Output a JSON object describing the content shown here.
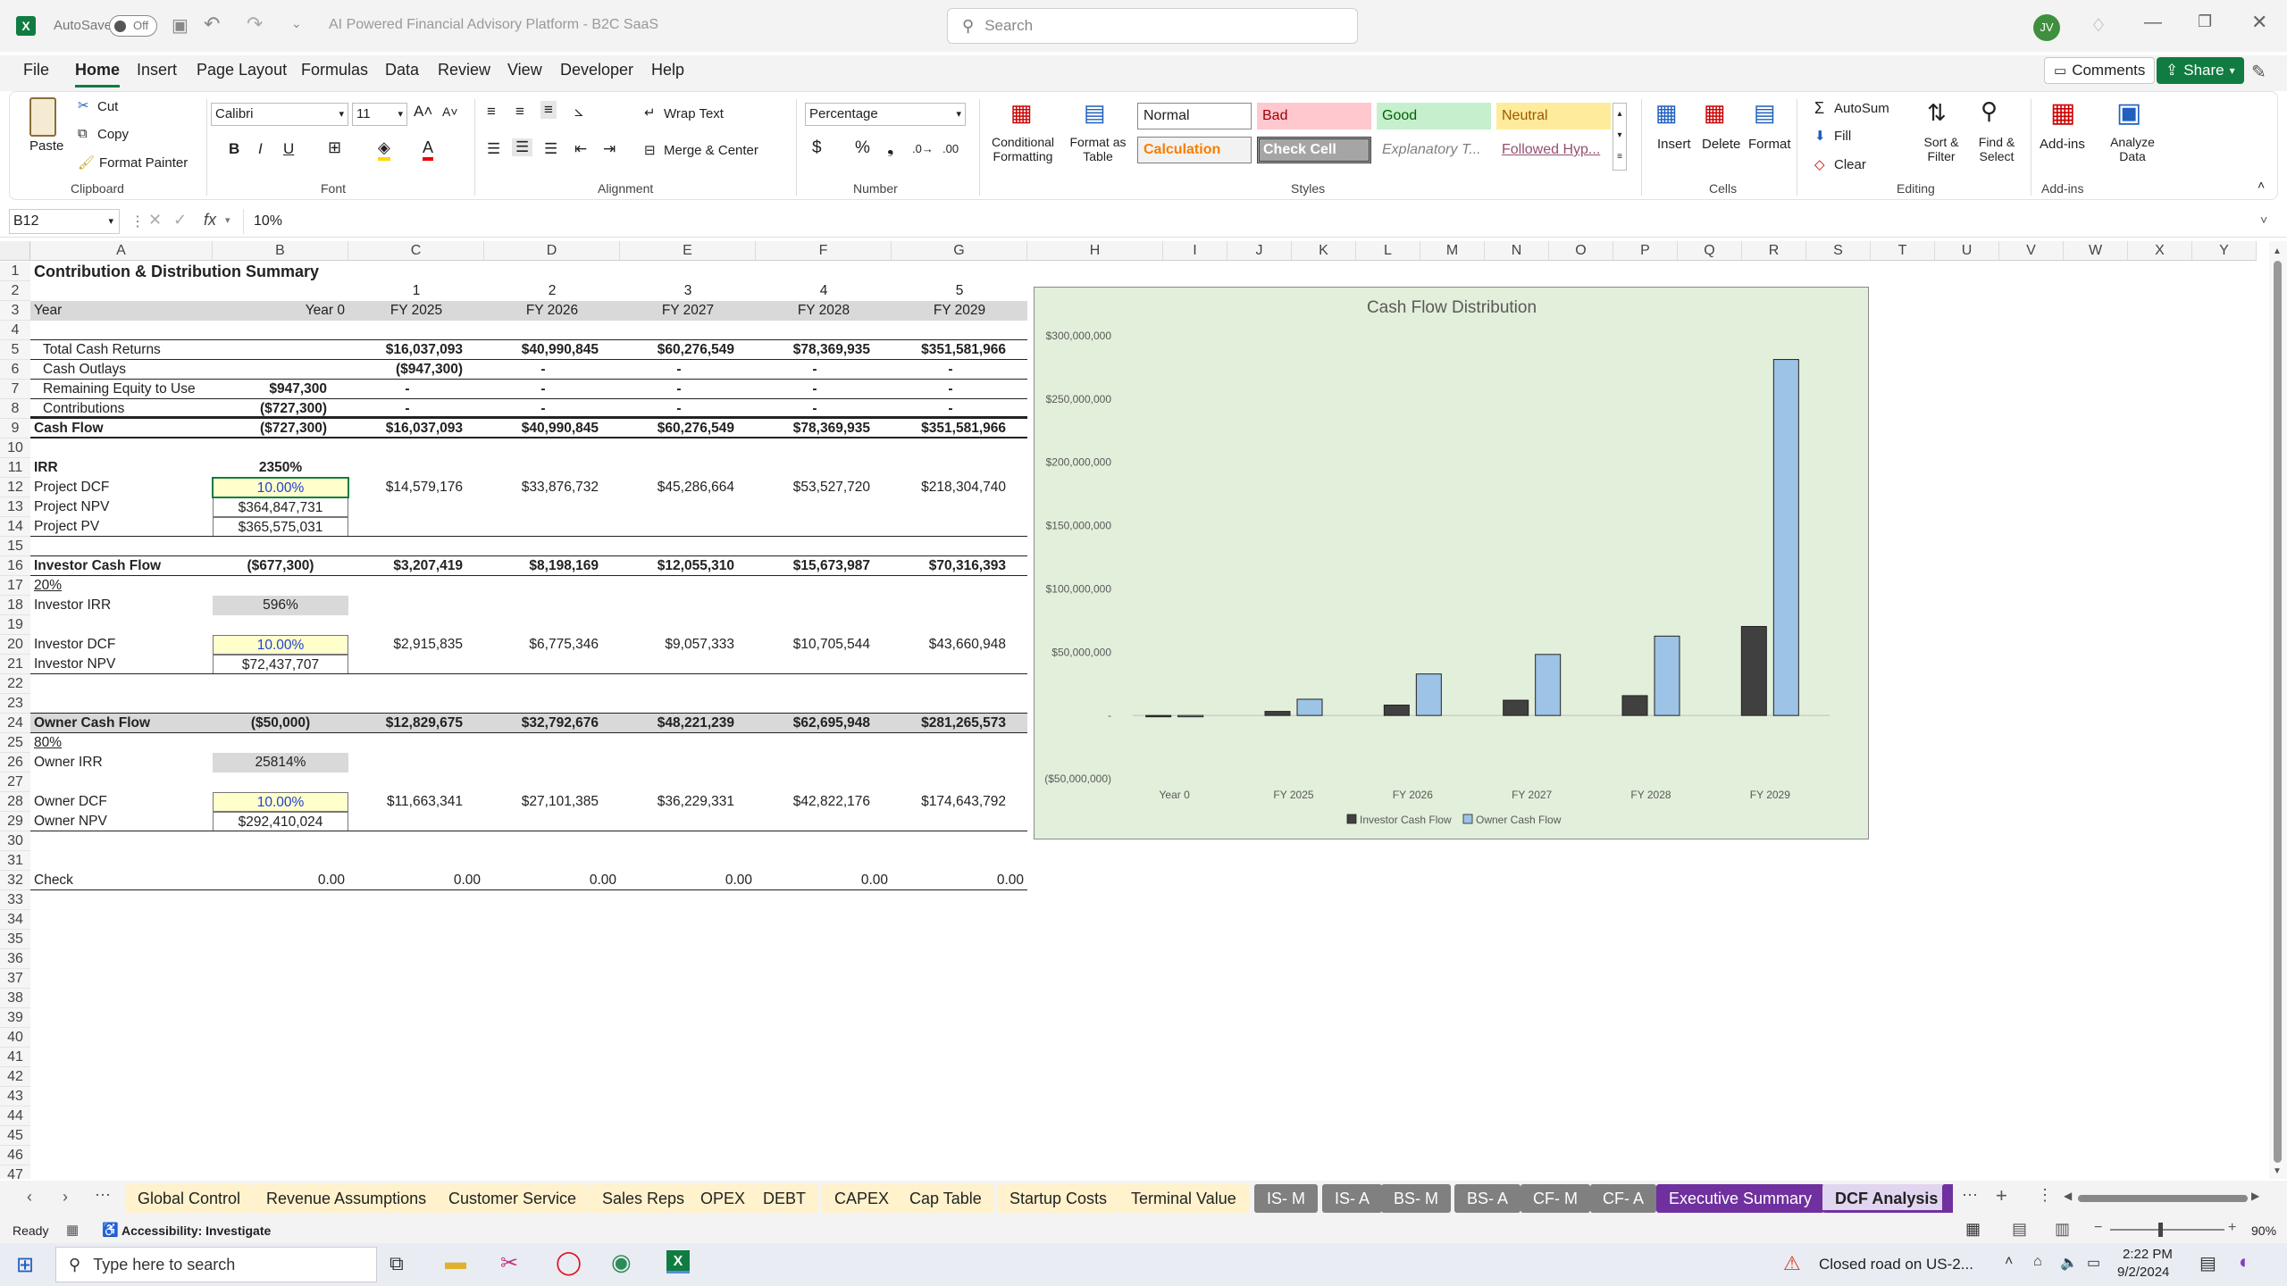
{
  "titlebar": {
    "autosave": "AutoSave",
    "toggle": "Off",
    "doc_title": "AI Powered Financial Advisory Platform - B2C SaaS",
    "search_placeholder": "Search",
    "avatar": "JV"
  },
  "menu": [
    "File",
    "Home",
    "Insert",
    "Page Layout",
    "Formulas",
    "Data",
    "Review",
    "View",
    "Developer",
    "Help"
  ],
  "menu_active": "Home",
  "comments": "Comments",
  "share": "Share",
  "ribbon": {
    "clipboard": {
      "paste": "Paste",
      "cut": "Cut",
      "copy": "Copy",
      "format_painter": "Format Painter",
      "label": "Clipboard"
    },
    "font": {
      "name": "Calibri",
      "size": "11",
      "label": "Font"
    },
    "alignment": {
      "wrap": "Wrap Text",
      "merge": "Merge & Center",
      "label": "Alignment"
    },
    "number": {
      "format": "Percentage",
      "label": "Number"
    },
    "styles": {
      "cond": "Conditional Formatting",
      "table": "Format as Table",
      "normal": "Normal",
      "bad": "Bad",
      "good": "Good",
      "neutral": "Neutral",
      "calc": "Calculation",
      "check": "Check Cell",
      "expl": "Explanatory T...",
      "followed": "Followed Hyp...",
      "label": "Styles"
    },
    "cells": {
      "insert": "Insert",
      "delete": "Delete",
      "format": "Format",
      "label": "Cells"
    },
    "editing": {
      "autosum": "AutoSum",
      "fill": "Fill",
      "clear": "Clear",
      "sort": "Sort & Filter",
      "find": "Find & Select",
      "label": "Editing"
    },
    "addins": {
      "addins": "Add-ins",
      "analyze": "Analyze Data",
      "label": "Add-ins"
    }
  },
  "formula": {
    "namebox": "B12",
    "fx": "fx",
    "value": "10%"
  },
  "columns": [
    "A",
    "B",
    "C",
    "D",
    "E",
    "F",
    "G",
    "H",
    "I",
    "J",
    "K",
    "L",
    "M",
    "N",
    "O",
    "P",
    "Q",
    "R",
    "S",
    "T",
    "U",
    "V",
    "W",
    "X",
    "Y"
  ],
  "rows": [
    "1",
    "2",
    "3",
    "4",
    "5",
    "6",
    "7",
    "8",
    "9",
    "10",
    "11",
    "12",
    "13",
    "14",
    "15",
    "16",
    "17",
    "18",
    "19",
    "20",
    "21",
    "22",
    "23",
    "24",
    "25",
    "26",
    "27",
    "28",
    "29",
    "30",
    "31",
    "32",
    "33",
    "34",
    "35",
    "36",
    "37",
    "38",
    "39",
    "40",
    "41",
    "42",
    "43",
    "44",
    "45",
    "46",
    "47"
  ],
  "sheet": {
    "title": "Contribution & Distribution Summary",
    "periods": [
      "1",
      "2",
      "3",
      "4",
      "5"
    ],
    "year_label": "Year",
    "years": [
      "Year 0",
      "FY 2025",
      "FY 2026",
      "FY 2027",
      "FY 2028",
      "FY 2029"
    ],
    "total_cash_returns": {
      "label": "Total Cash Returns",
      "vals": [
        "",
        "$16,037,093",
        "$40,990,845",
        "$60,276,549",
        "$78,369,935",
        "$351,581,966"
      ]
    },
    "cash_outlays": {
      "label": "Cash Outlays",
      "vals": [
        "",
        "($947,300)",
        "-",
        "-",
        "-",
        "-"
      ]
    },
    "remaining_equity": {
      "label": "Remaining Equity to Use",
      "vals": [
        "$947,300",
        "-",
        "-",
        "-",
        "-",
        "-"
      ]
    },
    "contributions": {
      "label": "Contributions",
      "vals": [
        "($727,300)",
        "-",
        "-",
        "-",
        "-",
        "-"
      ]
    },
    "cash_flow": {
      "label": "Cash Flow",
      "vals": [
        "($727,300)",
        "$16,037,093",
        "$40,990,845",
        "$60,276,549",
        "$78,369,935",
        "$351,581,966"
      ]
    },
    "irr": {
      "label": "IRR",
      "val": "2350%"
    },
    "project_dcf": {
      "label": "Project DCF",
      "vals": [
        "10.00%",
        "$14,579,176",
        "$33,876,732",
        "$45,286,664",
        "$53,527,720",
        "$218,304,740"
      ]
    },
    "project_npv": {
      "label": "Project NPV",
      "val": "$364,847,731"
    },
    "project_pv": {
      "label": "Project PV",
      "val": "$365,575,031"
    },
    "investor_cf": {
      "label": "Investor Cash Flow",
      "vals": [
        "($677,300)",
        "$3,207,419",
        "$8,198,169",
        "$12,055,310",
        "$15,673,987",
        "$70,316,393"
      ]
    },
    "investor_pct": "20%",
    "investor_irr": {
      "label": "Investor IRR",
      "val": "596%"
    },
    "investor_dcf": {
      "label": "Investor DCF",
      "vals": [
        "10.00%",
        "$2,915,835",
        "$6,775,346",
        "$9,057,333",
        "$10,705,544",
        "$43,660,948"
      ]
    },
    "investor_npv": {
      "label": "Investor NPV",
      "val": "$72,437,707"
    },
    "owner_cf": {
      "label": "Owner Cash Flow",
      "vals": [
        "($50,000)",
        "$12,829,675",
        "$32,792,676",
        "$48,221,239",
        "$62,695,948",
        "$281,265,573"
      ]
    },
    "owner_pct": "80%",
    "owner_irr": {
      "label": "Owner IRR",
      "val": "25814%"
    },
    "owner_dcf": {
      "label": "Owner DCF",
      "vals": [
        "10.00%",
        "$11,663,341",
        "$27,101,385",
        "$36,229,331",
        "$42,822,176",
        "$174,643,792"
      ]
    },
    "owner_npv": {
      "label": "Owner NPV",
      "val": "$292,410,024"
    },
    "check": {
      "label": "Check",
      "vals": [
        "0.00",
        "0.00",
        "0.00",
        "0.00",
        "0.00",
        "0.00"
      ]
    }
  },
  "chart_data": {
    "type": "bar",
    "title": "Cash Flow Distribution",
    "categories": [
      "Year 0",
      "FY 2025",
      "FY 2026",
      "FY 2027",
      "FY 2028",
      "FY 2029"
    ],
    "series": [
      {
        "name": "Investor Cash Flow",
        "color": "#404040",
        "values": [
          -677300,
          3207419,
          8198169,
          12055310,
          15673987,
          70316393
        ]
      },
      {
        "name": "Owner Cash Flow",
        "color": "#9dc3e6",
        "values": [
          -50000,
          12829675,
          32792676,
          48221239,
          62695948,
          281265573
        ]
      }
    ],
    "ylim": [
      -50000000,
      300000000
    ],
    "yticks": [
      "($50,000,000)",
      "-",
      "$50,000,000",
      "$100,000,000",
      "$150,000,000",
      "$200,000,000",
      "$250,000,000",
      "$300,000,000"
    ],
    "legend": "bottom"
  },
  "tabs": [
    {
      "name": "Global Control",
      "bg": "#fff2cc",
      "fg": "#222"
    },
    {
      "name": "Revenue Assumptions",
      "bg": "#fff2cc",
      "fg": "#222"
    },
    {
      "name": "Customer Service",
      "bg": "#fff2cc",
      "fg": "#222"
    },
    {
      "name": "Sales Reps",
      "bg": "#fff2cc",
      "fg": "#222"
    },
    {
      "name": "OPEX",
      "bg": "#fff2cc",
      "fg": "#222"
    },
    {
      "name": "DEBT",
      "bg": "#fff2cc",
      "fg": "#222"
    },
    {
      "name": "CAPEX",
      "bg": "#fff2cc",
      "fg": "#222"
    },
    {
      "name": "Cap Table",
      "bg": "#fff2cc",
      "fg": "#222"
    },
    {
      "name": "Startup Costs",
      "bg": "#fff2cc",
      "fg": "#222"
    },
    {
      "name": "Terminal Value",
      "bg": "#fff2cc",
      "fg": "#222"
    },
    {
      "name": "IS- M",
      "bg": "#808080",
      "fg": "#fff"
    },
    {
      "name": "IS- A",
      "bg": "#808080",
      "fg": "#fff"
    },
    {
      "name": "BS- M",
      "bg": "#808080",
      "fg": "#fff"
    },
    {
      "name": "BS- A",
      "bg": "#808080",
      "fg": "#fff"
    },
    {
      "name": "CF- M",
      "bg": "#808080",
      "fg": "#fff"
    },
    {
      "name": "CF- A",
      "bg": "#808080",
      "fg": "#fff"
    },
    {
      "name": "Executive Summary",
      "bg": "#7030a0",
      "fg": "#fff"
    },
    {
      "name": "DCF Analysis",
      "bg": "#e2d5f0",
      "fg": "#222"
    }
  ],
  "status": {
    "ready": "Ready",
    "accessibility": "Accessibility: Investigate",
    "zoom": "90%"
  },
  "taskbar": {
    "search": "Type here to search",
    "weather": "Closed road on US-2...",
    "time": "2:22 PM",
    "date": "9/2/2024"
  }
}
